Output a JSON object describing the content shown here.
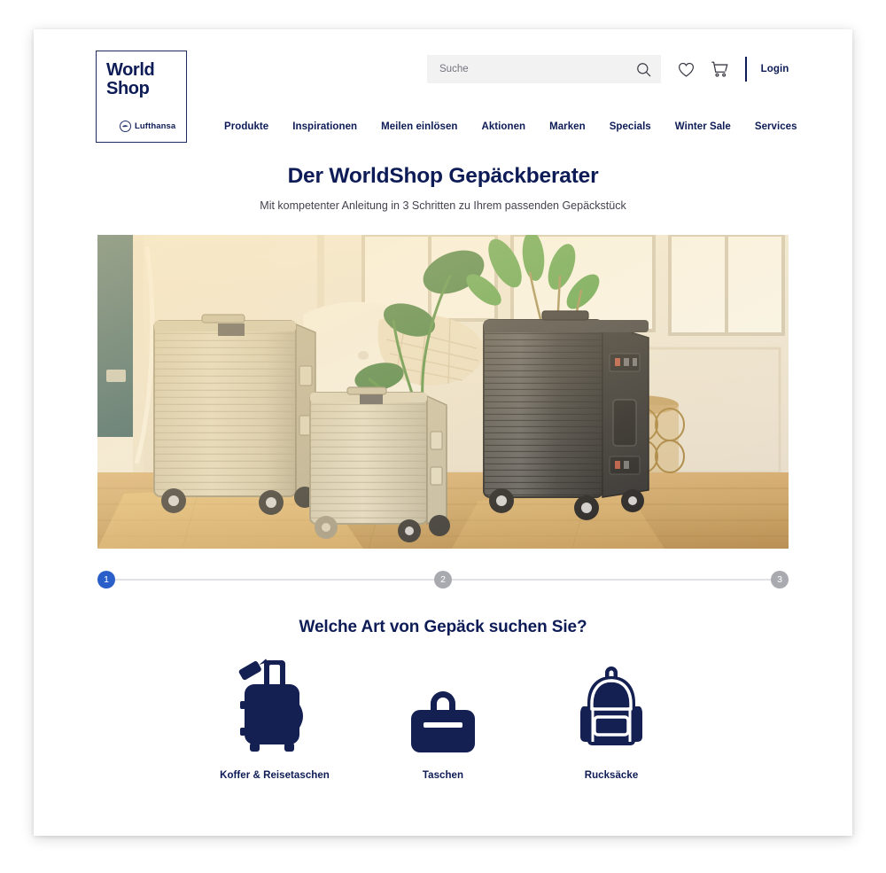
{
  "brand": {
    "logo_line1": "World",
    "logo_line2": "Shop",
    "airline": "Lufthansa",
    "navy": "#0d1b56",
    "accent_blue": "#2a5fc9",
    "inactive_gray": "#a9a9b0"
  },
  "header": {
    "search": {
      "placeholder": "Suche",
      "value": "",
      "icon": "search-icon"
    },
    "wishlist_icon": "heart-icon",
    "cart_icon": "shopping-cart-icon",
    "login_label": "Login",
    "nav": [
      {
        "label": "Produkte"
      },
      {
        "label": "Inspirationen"
      },
      {
        "label": "Meilen einlösen"
      },
      {
        "label": "Aktionen"
      },
      {
        "label": "Marken"
      },
      {
        "label": "Specials"
      },
      {
        "label": "Winter Sale"
      },
      {
        "label": "Services"
      }
    ]
  },
  "page": {
    "title": "Der WorldShop Gepäckberater",
    "subtitle": "Mit kompetenter Anleitung in 3 Schritten zu Ihrem passenden Gepäckstück"
  },
  "hero": {
    "alt": "Drei Aluminium-Koffer in einem hellen Wohnraum mit Holzboden, Sessel und Pflanzen"
  },
  "stepper": {
    "steps": [
      {
        "number": "1",
        "state": "active"
      },
      {
        "number": "2",
        "state": "inactive"
      },
      {
        "number": "3",
        "state": "inactive"
      }
    ]
  },
  "question": "Welche Art von Gepäck suchen Sie?",
  "options": [
    {
      "label": "Koffer & Reisetaschen",
      "icon": "suitcase-icon"
    },
    {
      "label": "Taschen",
      "icon": "bag-icon"
    },
    {
      "label": "Rucksäcke",
      "icon": "backpack-icon"
    }
  ]
}
